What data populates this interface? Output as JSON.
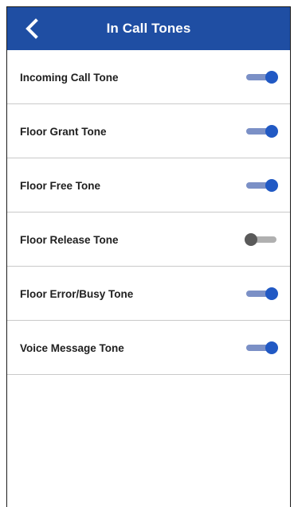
{
  "header": {
    "title": "In Call Tones",
    "back_icon": "chevron-left-icon"
  },
  "colors": {
    "header_background": "#1f4ea3",
    "toggle_on_knob": "#2159c4",
    "toggle_on_track": "#7b90c6",
    "toggle_off_knob": "#5a5a5a",
    "toggle_off_track": "#b0b0b0"
  },
  "settings": [
    {
      "label": "Incoming Call Tone",
      "enabled": true
    },
    {
      "label": "Floor Grant Tone",
      "enabled": true
    },
    {
      "label": "Floor Free Tone",
      "enabled": true
    },
    {
      "label": "Floor Release Tone",
      "enabled": false
    },
    {
      "label": "Floor Error/Busy Tone",
      "enabled": true
    },
    {
      "label": "Voice Message Tone",
      "enabled": true
    }
  ]
}
